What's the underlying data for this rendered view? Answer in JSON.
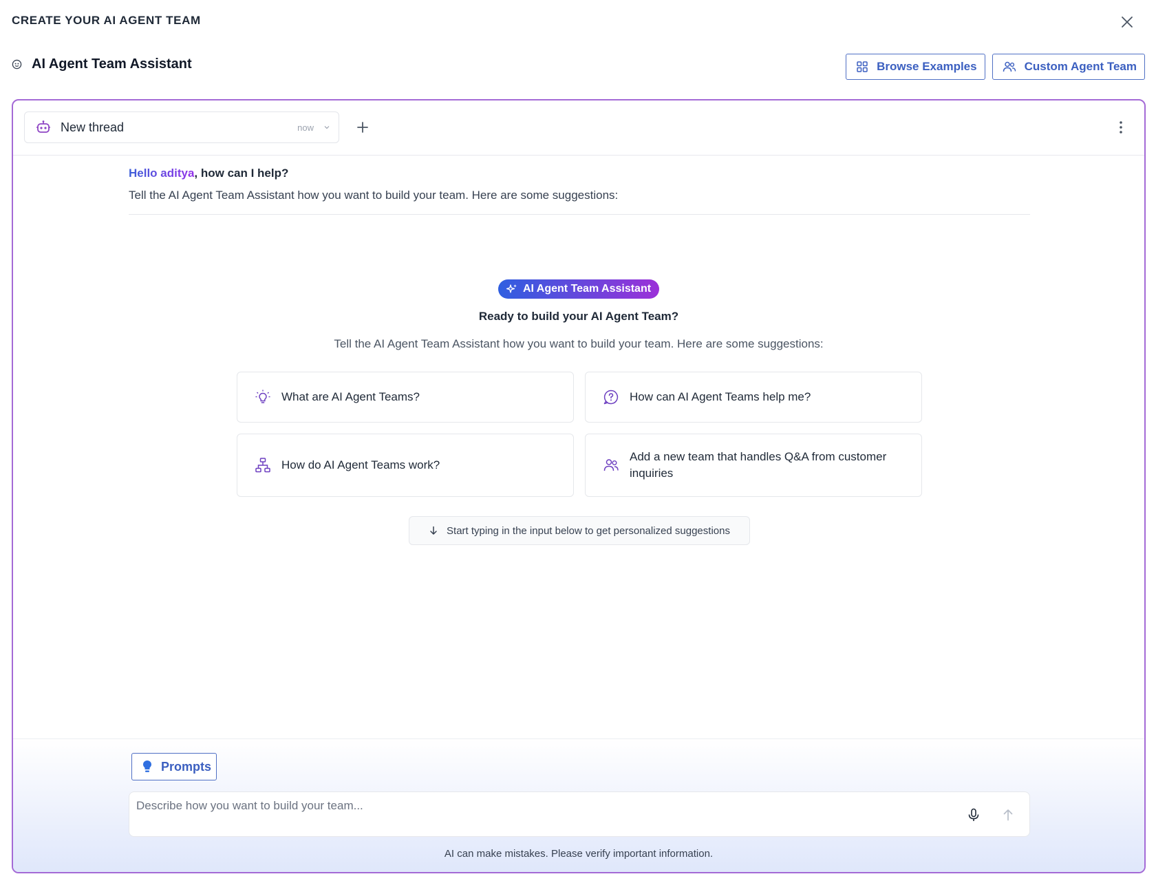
{
  "modal": {
    "title": "CREATE YOUR AI AGENT TEAM"
  },
  "header": {
    "assistant_title": "AI Agent Team Assistant",
    "browse_examples_label": "Browse Examples",
    "custom_agent_team_label": "Custom Agent Team"
  },
  "thread": {
    "name": "New thread",
    "time": "now"
  },
  "greeting": {
    "hello": "Hello aditya",
    "rest": ", how can I help?",
    "subtitle": "Tell the AI Agent Team Assistant how you want to build your team. Here are some suggestions:"
  },
  "center": {
    "pill_label": "AI Agent Team Assistant",
    "heading": "Ready to build your AI Agent Team?",
    "subtitle": "Tell the AI Agent Team Assistant how you want to build your team. Here are some suggestions:"
  },
  "suggestions": [
    {
      "label": "What are AI Agent Teams?",
      "icon": "lightbulb-icon"
    },
    {
      "label": "How can AI Agent Teams help me?",
      "icon": "question-bubble-icon"
    },
    {
      "label": "How do AI Agent Teams work?",
      "icon": "hierarchy-icon"
    },
    {
      "label": "Add a new team that handles Q&A from customer inquiries",
      "icon": "users-icon"
    }
  ],
  "hint": {
    "text": "Start typing in the input below to get personalized suggestions"
  },
  "composer": {
    "prompts_label": "Prompts",
    "placeholder": "Describe how you want to build your team...",
    "disclaimer": "AI can make mistakes. Please verify important information."
  },
  "colors": {
    "accent_blue": "#3b5fc0",
    "accent_purple": "#9333ea",
    "panel_border": "#a46ad6"
  }
}
